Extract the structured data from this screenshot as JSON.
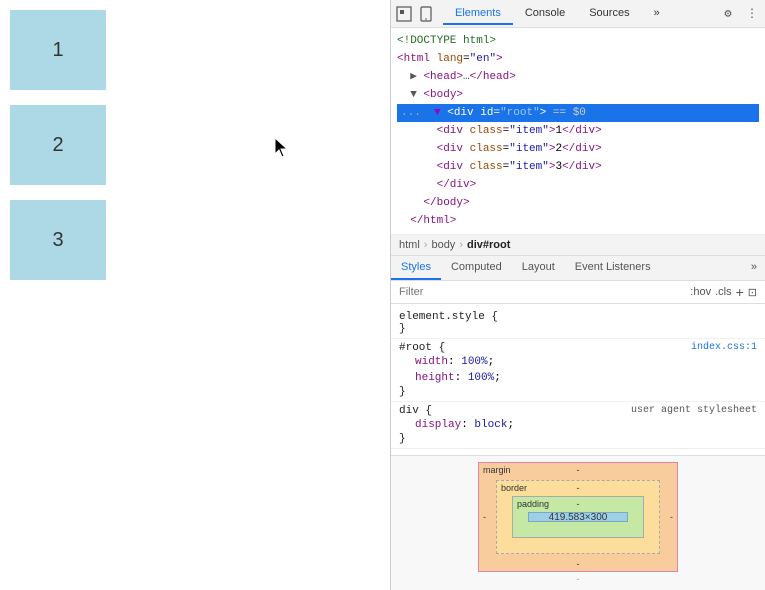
{
  "webpage": {
    "items": [
      {
        "label": "1"
      },
      {
        "label": "2"
      },
      {
        "label": "3"
      }
    ]
  },
  "devtools": {
    "toolbar": {
      "inspector_icon": "⬚",
      "device_icon": "📱",
      "more_icon": "»",
      "settings_icon": "⚙",
      "kebab_icon": "⋮",
      "close_icon": "✕"
    },
    "top_tabs": [
      {
        "label": "Elements",
        "active": true
      },
      {
        "label": "Console",
        "active": false
      },
      {
        "label": "Sources",
        "active": false
      },
      {
        "label": "»",
        "active": false
      }
    ],
    "html_tree": {
      "lines": [
        {
          "indent": 0,
          "content": "<!DOCTYPE html>",
          "selected": false
        },
        {
          "indent": 0,
          "content": "<html lang=\"en\">",
          "selected": false
        },
        {
          "indent": 1,
          "content": "▶ <head>…</head>",
          "selected": false
        },
        {
          "indent": 1,
          "content": "▼ <body>",
          "selected": false
        },
        {
          "indent": 2,
          "content": "... ▼ <div id=\"root\"> == $0",
          "selected": true
        },
        {
          "indent": 3,
          "content": "<div class=\"item\">1</div>",
          "selected": false
        },
        {
          "indent": 3,
          "content": "<div class=\"item\">2</div>",
          "selected": false
        },
        {
          "indent": 3,
          "content": "<div class=\"item\">3</div>",
          "selected": false
        },
        {
          "indent": 3,
          "content": "</div>",
          "selected": false
        },
        {
          "indent": 2,
          "content": "</body>",
          "selected": false
        },
        {
          "indent": 1,
          "content": "</html>",
          "selected": false
        }
      ]
    },
    "breadcrumb": [
      {
        "label": "html",
        "current": false
      },
      {
        "label": "body",
        "current": false
      },
      {
        "label": "div#root",
        "current": true
      }
    ],
    "panel_tabs": [
      {
        "label": "Styles",
        "active": true
      },
      {
        "label": "Computed",
        "active": false
      },
      {
        "label": "Layout",
        "active": false
      },
      {
        "label": "Event Listeners",
        "active": false
      },
      {
        "label": "»",
        "active": false
      }
    ],
    "filter": {
      "placeholder": "Filter",
      "hov_label": ":hov",
      "cls_label": ".cls",
      "plus_label": "+",
      "expand_label": "⊡"
    },
    "css_rules": [
      {
        "selector": "element.style {",
        "source": "",
        "properties": [],
        "closing": "}"
      },
      {
        "selector": "#root {",
        "source": "index.css:1",
        "properties": [
          {
            "name": "width",
            "value": "100%;"
          },
          {
            "name": "height",
            "value": "100%;"
          }
        ],
        "closing": "}"
      },
      {
        "selector": "div {",
        "source": "user agent stylesheet",
        "properties": [
          {
            "name": "display",
            "value": "block;"
          }
        ],
        "closing": "}"
      }
    ],
    "box_model": {
      "margin_label": "margin",
      "margin_top": "-",
      "margin_bottom": "-",
      "margin_left": "-",
      "margin_right": "-",
      "border_label": "border",
      "border_top": "-",
      "padding_label": "padding",
      "padding_top": "-",
      "content_size": "419.583×300",
      "bottom_dash": "-"
    }
  }
}
